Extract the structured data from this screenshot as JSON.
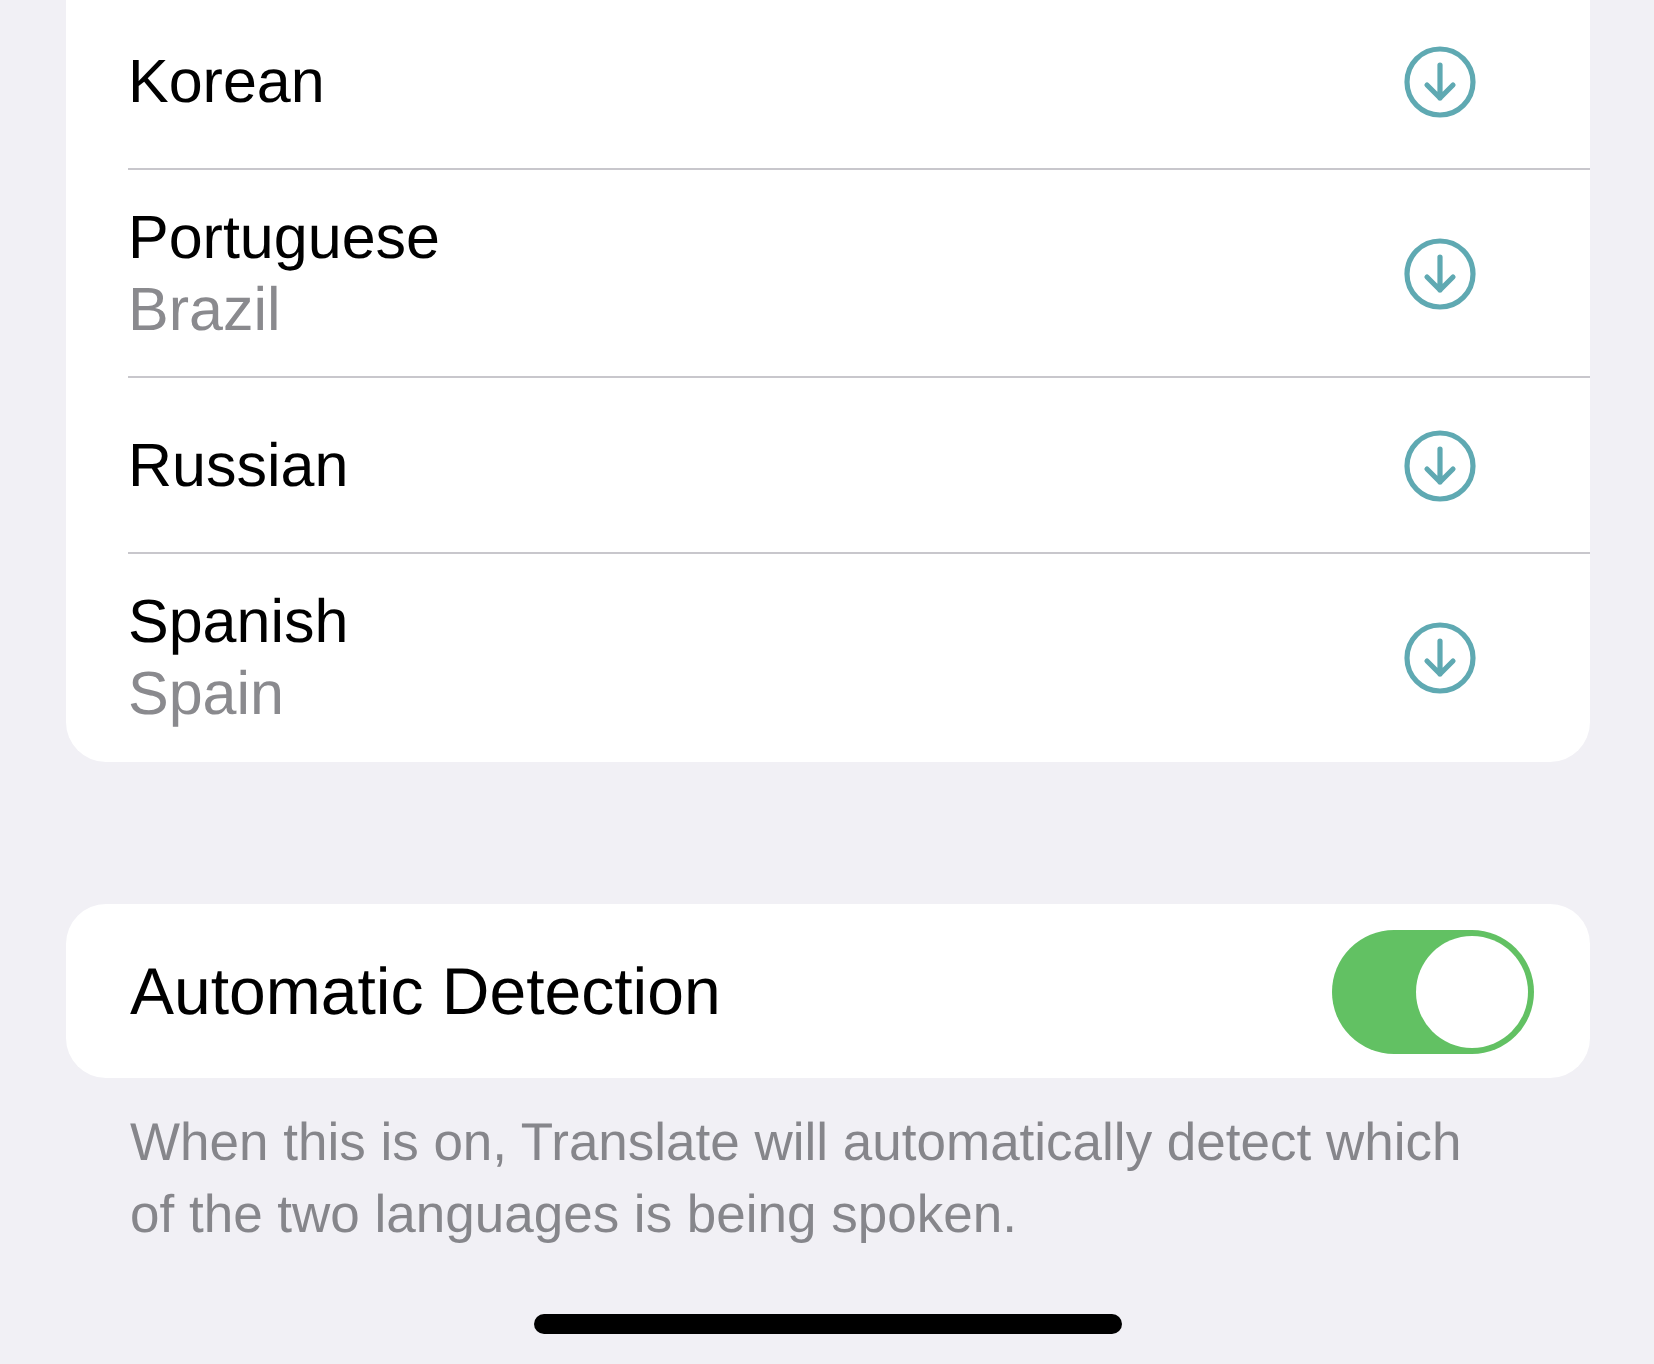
{
  "languages": [
    {
      "name": "Korean"
    },
    {
      "name": "Portuguese",
      "region": "Brazil"
    },
    {
      "name": "Russian"
    },
    {
      "name": "Spanish",
      "region": "Spain"
    }
  ],
  "automatic_detection": {
    "label": "Automatic Detection",
    "on": true
  },
  "footer": "When this is on, Translate will automatically detect which of the two languages is being spoken."
}
